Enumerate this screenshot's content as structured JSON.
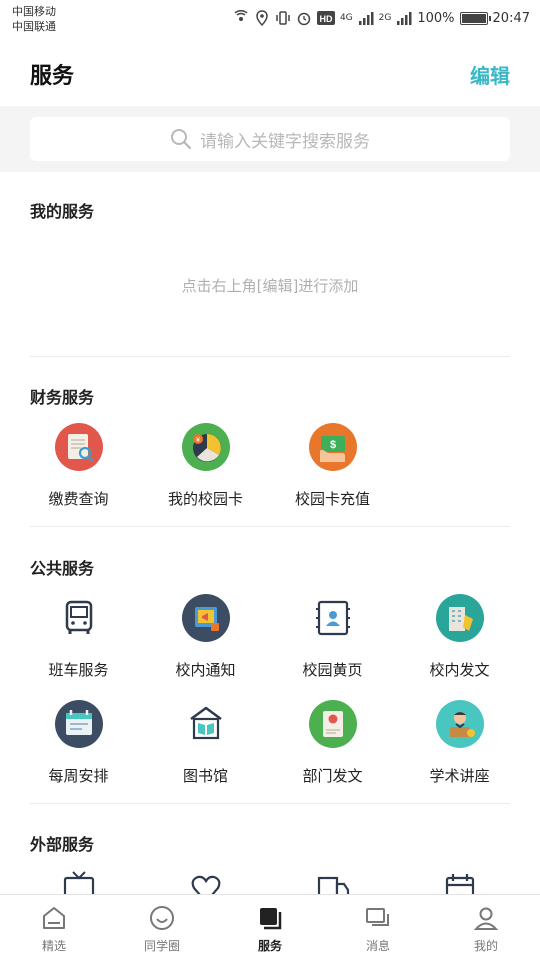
{
  "status_bar": {
    "carrier_1": "中国移动",
    "carrier_2": "中国联通",
    "network_1": "4G",
    "network_2": "2G",
    "battery": "100%",
    "time": "20:47"
  },
  "header": {
    "title": "服务",
    "edit_label": "编辑"
  },
  "search": {
    "placeholder": "请输入关键字搜索服务"
  },
  "my_services": {
    "title": "我的服务",
    "hint": "点击右上角[编辑]进行添加"
  },
  "finance_services": {
    "title": "财务服务",
    "items": [
      {
        "label": "缴费查询",
        "icon": "receipt-search-icon"
      },
      {
        "label": "我的校园卡",
        "icon": "pie-chart-icon"
      },
      {
        "label": "校园卡充值",
        "icon": "money-hand-icon"
      }
    ]
  },
  "public_services": {
    "title": "公共服务",
    "items": [
      {
        "label": "班车服务",
        "icon": "bus-icon"
      },
      {
        "label": "校内通知",
        "icon": "notice-icon"
      },
      {
        "label": "校园黄页",
        "icon": "contact-card-icon"
      },
      {
        "label": "校内发文",
        "icon": "building-icon"
      },
      {
        "label": "每周安排",
        "icon": "calendar-icon"
      },
      {
        "label": "图书馆",
        "icon": "library-icon"
      },
      {
        "label": "部门发文",
        "icon": "department-icon"
      },
      {
        "label": "学术讲座",
        "icon": "lecture-icon"
      }
    ]
  },
  "external_services": {
    "title": "外部服务"
  },
  "tabbar": {
    "tabs": [
      {
        "label": "精选",
        "icon": "home-icon"
      },
      {
        "label": "同学圈",
        "icon": "smile-icon"
      },
      {
        "label": "服务",
        "icon": "service-icon"
      },
      {
        "label": "消息",
        "icon": "message-icon"
      },
      {
        "label": "我的",
        "icon": "user-icon"
      }
    ],
    "active": "服务"
  },
  "colors": {
    "accent": "#3bb8c8",
    "active_tab": "#222222"
  }
}
